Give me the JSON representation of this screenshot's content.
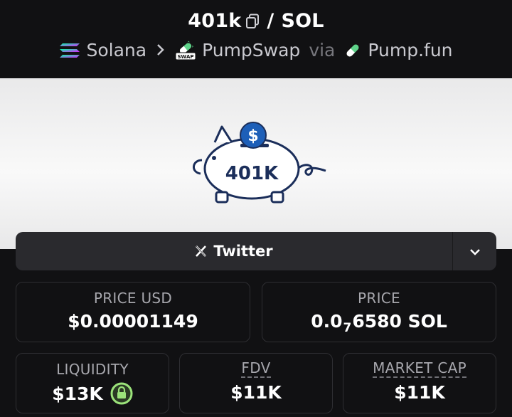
{
  "header": {
    "token": "401k",
    "separator": "/",
    "quote": "SOL",
    "chain": "Solana",
    "dex": "PumpSwap",
    "via": "via",
    "launchpad": "Pump.fun",
    "icons": [
      "copy-icon",
      "solana-icon",
      "chevron-right-icon",
      "pumpswap-icon",
      "pumpfun-icon"
    ]
  },
  "banner": {
    "logo_text": "401K"
  },
  "social": {
    "twitter_label": "Twitter"
  },
  "stats": {
    "price_usd": {
      "label": "PRICE USD",
      "value": "$0.00001149"
    },
    "price": {
      "label": "PRICE",
      "value_prefix": "0.0",
      "zeros": "7",
      "value_suffix": "6580 SOL"
    },
    "liquidity": {
      "label": "LIQUIDITY",
      "value": "$13K"
    },
    "fdv": {
      "label": "FDV",
      "value": "$11K"
    },
    "market_cap": {
      "label": "MARKET CAP",
      "value": "$11K"
    }
  },
  "colors": {
    "background": "#111113",
    "card_border": "#2e2e32",
    "button_bg": "#2a2a2e",
    "lock_green": "#9be37a",
    "piggy_blue": "#1d5fb8"
  }
}
